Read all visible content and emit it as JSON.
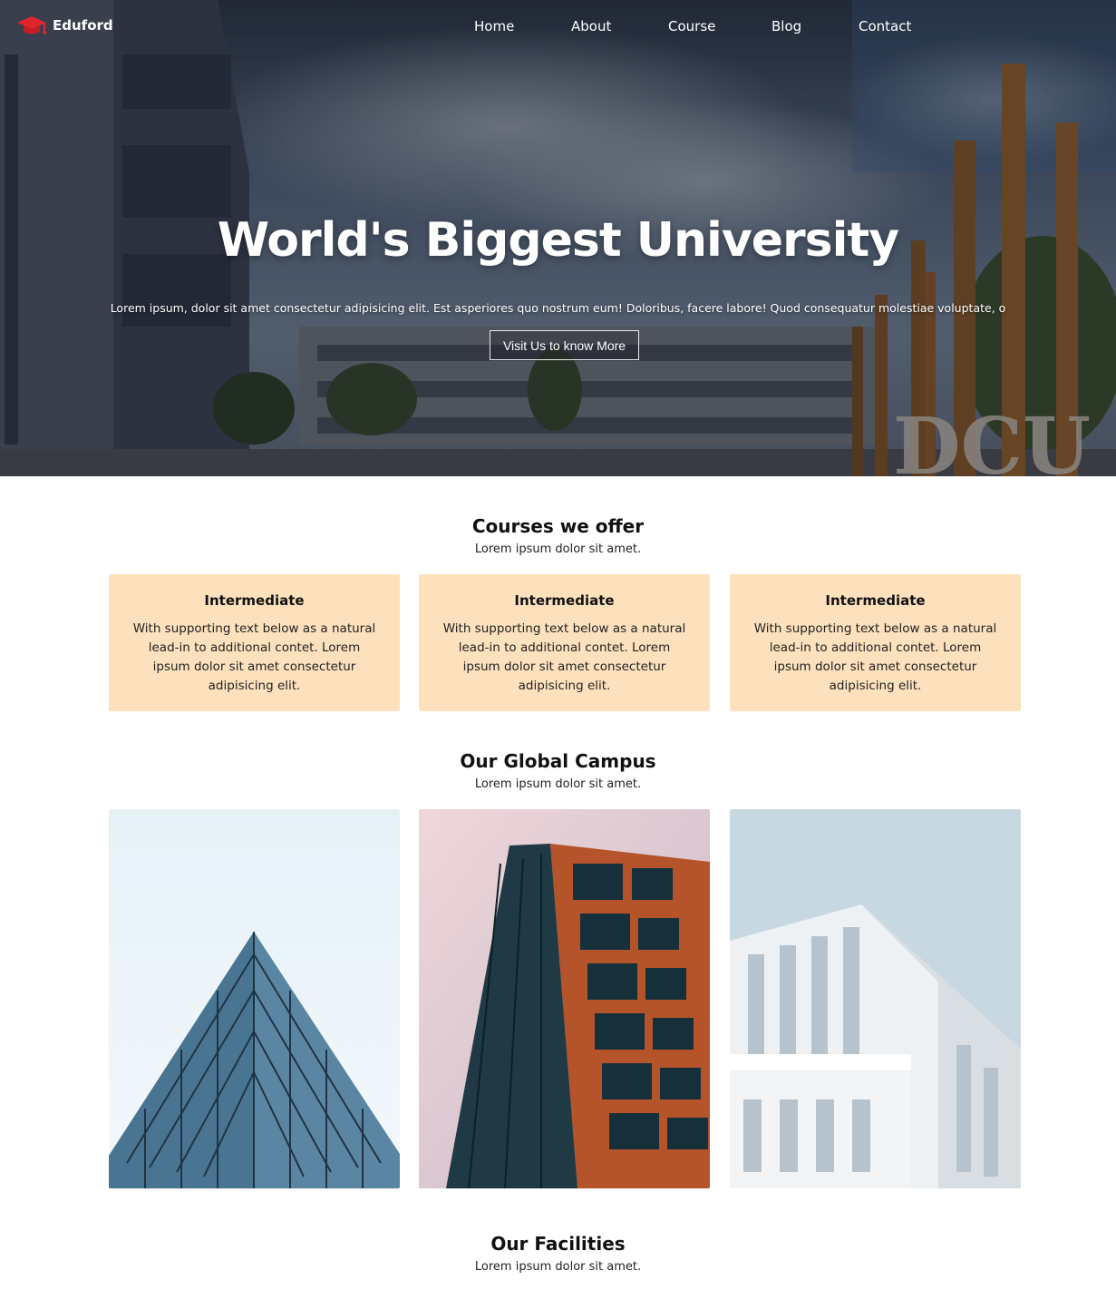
{
  "brand": {
    "name": "Eduford",
    "logo_icon": "graduation-cap-icon",
    "accent_color": "#e0242b"
  },
  "nav": {
    "items": [
      {
        "label": "Home"
      },
      {
        "label": "About"
      },
      {
        "label": "Course"
      },
      {
        "label": "Blog"
      },
      {
        "label": "Contact"
      }
    ]
  },
  "hero": {
    "title": "World's Biggest University",
    "text": "Lorem ipsum, dolor sit amet consectetur adipisicing elit. Est asperiores quo nostrum eum! Doloribus, facere labore! Quod consequatur molestiae voluptate, o",
    "cta_label": "Visit Us to know More",
    "sign_text": "DCU"
  },
  "courses": {
    "title": "Courses we offer",
    "subtitle": "Lorem ipsum dolor sit amet.",
    "card_color": "#fde1bd",
    "items": [
      {
        "title": "Intermediate",
        "text": "With supporting text below as a natural lead-in to additional contet. Lorem ipsum dolor sit amet consectetur adipisicing elit."
      },
      {
        "title": "Intermediate",
        "text": "With supporting text below as a natural lead-in to additional contet. Lorem ipsum dolor sit amet consectetur adipisicing elit."
      },
      {
        "title": "Intermediate",
        "text": "With supporting text below as a natural lead-in to additional contet. Lorem ipsum dolor sit amet consectetur adipisicing elit."
      }
    ]
  },
  "campus": {
    "title": "Our Global Campus",
    "subtitle": "Lorem ipsum dolor sit amet."
  },
  "facilities": {
    "title": "Our Facilities",
    "subtitle": "Lorem ipsum dolor sit amet."
  }
}
